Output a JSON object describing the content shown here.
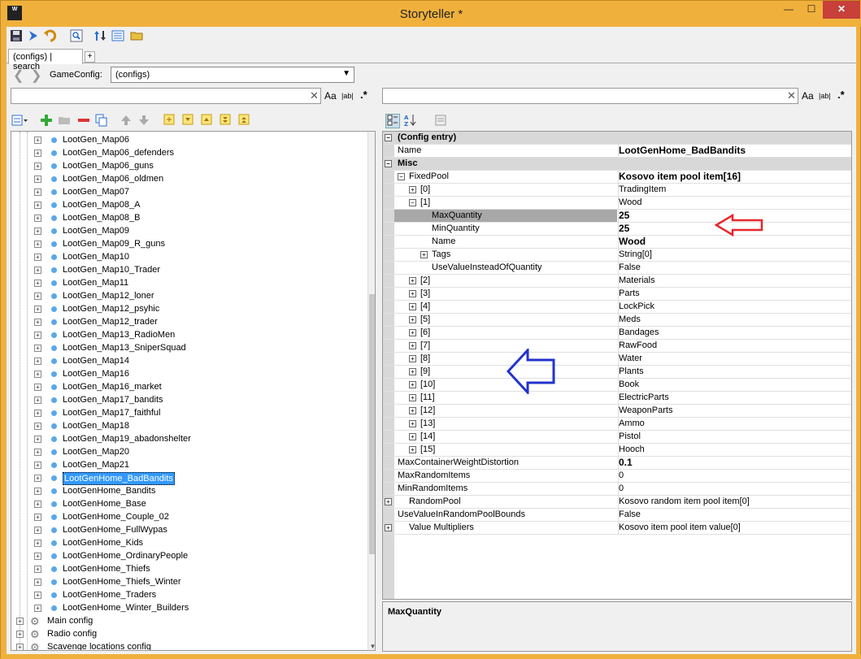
{
  "window": {
    "title": "Storyteller *",
    "min": "—",
    "max": "☐",
    "close": "✕",
    "icon_text": "W"
  },
  "toolbar": {
    "icons": [
      "save-icon",
      "run-icon",
      "undo-icon",
      "find-icon",
      "sort-icon",
      "list-icon",
      "folder-icon"
    ]
  },
  "tabs": [
    {
      "label": "(configs) | search"
    }
  ],
  "tab_add": "+",
  "nav": {
    "back": "❮",
    "forward": "❯",
    "label": "GameConfig:",
    "selected": "(configs)"
  },
  "left_search": {
    "value": "",
    "clear": "✕",
    "opt_case": "Aa",
    "opt_word": "|ab|",
    "opt_regex": ".*"
  },
  "right_search": {
    "value": "",
    "clear": "✕",
    "opt_case": "Aa",
    "opt_word": "|ab|",
    "opt_regex": ".*"
  },
  "tree": {
    "items": [
      "LootGen_Map06",
      "LootGen_Map06_defenders",
      "LootGen_Map06_guns",
      "LootGen_Map06_oldmen",
      "LootGen_Map07",
      "LootGen_Map08_A",
      "LootGen_Map08_B",
      "LootGen_Map09",
      "LootGen_Map09_R_guns",
      "LootGen_Map10",
      "LootGen_Map10_Trader",
      "LootGen_Map11",
      "LootGen_Map12_loner",
      "LootGen_Map12_psyhic",
      "LootGen_Map12_trader",
      "LootGen_Map13_RadioMen",
      "LootGen_Map13_SniperSquad",
      "LootGen_Map14",
      "LootGen_Map16",
      "LootGen_Map16_market",
      "LootGen_Map17_bandits",
      "LootGen_Map17_faithful",
      "LootGen_Map18",
      "LootGen_Map19_abadonshelter",
      "LootGen_Map20",
      "LootGen_Map21",
      "LootGenHome_BadBandits",
      "LootGenHome_Bandits",
      "LootGenHome_Base",
      "LootGenHome_Couple_02",
      "LootGenHome_FullWypas",
      "LootGenHome_Kids",
      "LootGenHome_OrdinaryPeople",
      "LootGenHome_Thiefs",
      "LootGenHome_Thiefs_Winter",
      "LootGenHome_Traders",
      "LootGenHome_Winter_Builders"
    ],
    "selected_index": 26,
    "roots": [
      "Main config",
      "Radio config",
      "Scavenge locations config"
    ]
  },
  "grid": {
    "rows": [
      {
        "type": "cat",
        "name": "(Config entry)",
        "value": "",
        "pm": "⊟",
        "indent": 0
      },
      {
        "type": "prop",
        "name": "Name",
        "value": "LootGenHome_BadBandits",
        "bold": true,
        "indent": 0
      },
      {
        "type": "cat",
        "name": "Misc",
        "value": "",
        "pm": "⊟",
        "indent": 0
      },
      {
        "type": "prop",
        "name": "FixedPool",
        "value": "Kosovo item pool item[16]",
        "bold": true,
        "pm": "⊟",
        "indent": 0
      },
      {
        "type": "prop",
        "name": "[0]",
        "value": "TradingItem",
        "pm": "⊞",
        "indent": 1
      },
      {
        "type": "prop",
        "name": "[1]",
        "value": "Wood",
        "pm": "⊟",
        "indent": 1
      },
      {
        "type": "prop",
        "name": "MaxQuantity",
        "value": "25",
        "bold": true,
        "indent": 2,
        "selected": true
      },
      {
        "type": "prop",
        "name": "MinQuantity",
        "value": "25",
        "bold": true,
        "indent": 2
      },
      {
        "type": "prop",
        "name": "Name",
        "value": "Wood",
        "bold": true,
        "indent": 2
      },
      {
        "type": "prop",
        "name": "Tags",
        "value": "String[0]",
        "pm": "⊞",
        "indent": 2
      },
      {
        "type": "prop",
        "name": "UseValueInsteadOfQuantity",
        "value": "False",
        "indent": 2
      },
      {
        "type": "prop",
        "name": "[2]",
        "value": "Materials",
        "pm": "⊞",
        "indent": 1
      },
      {
        "type": "prop",
        "name": "[3]",
        "value": "Parts",
        "pm": "⊞",
        "indent": 1
      },
      {
        "type": "prop",
        "name": "[4]",
        "value": "LockPick",
        "pm": "⊞",
        "indent": 1
      },
      {
        "type": "prop",
        "name": "[5]",
        "value": "Meds",
        "pm": "⊞",
        "indent": 1
      },
      {
        "type": "prop",
        "name": "[6]",
        "value": "Bandages",
        "pm": "⊞",
        "indent": 1
      },
      {
        "type": "prop",
        "name": "[7]",
        "value": "RawFood",
        "pm": "⊞",
        "indent": 1
      },
      {
        "type": "prop",
        "name": "[8]",
        "value": "Water",
        "pm": "⊞",
        "indent": 1
      },
      {
        "type": "prop",
        "name": "[9]",
        "value": "Plants",
        "pm": "⊞",
        "indent": 1
      },
      {
        "type": "prop",
        "name": "[10]",
        "value": "Book",
        "pm": "⊞",
        "indent": 1
      },
      {
        "type": "prop",
        "name": "[11]",
        "value": "ElectricParts",
        "pm": "⊞",
        "indent": 1
      },
      {
        "type": "prop",
        "name": "[12]",
        "value": "WeaponParts",
        "pm": "⊞",
        "indent": 1
      },
      {
        "type": "prop",
        "name": "[13]",
        "value": "Ammo",
        "pm": "⊞",
        "indent": 1
      },
      {
        "type": "prop",
        "name": "[14]",
        "value": "Pistol",
        "pm": "⊞",
        "indent": 1
      },
      {
        "type": "prop",
        "name": "[15]",
        "value": "Hooch",
        "pm": "⊞",
        "indent": 1
      },
      {
        "type": "prop",
        "name": "MaxContainerWeightDistortion",
        "value": "0.1",
        "bold": true,
        "indent": 0
      },
      {
        "type": "prop",
        "name": "MaxRandomItems",
        "value": "0",
        "indent": 0
      },
      {
        "type": "prop",
        "name": "MinRandomItems",
        "value": "0",
        "indent": 0
      },
      {
        "type": "prop",
        "name": "RandomPool",
        "value": "Kosovo random item pool item[0]",
        "pm": "⊞",
        "indent": 0,
        "gutterpm": true
      },
      {
        "type": "prop",
        "name": "UseValueInRandomPoolBounds",
        "value": "False",
        "indent": 0
      },
      {
        "type": "prop",
        "name": "Value Multipliers",
        "value": "Kosovo item pool item value[0]",
        "pm": "⊞",
        "indent": 0,
        "gutterpm": true
      }
    ]
  },
  "description": {
    "title": "MaxQuantity"
  },
  "colors": {
    "title_bg": "#f0b13c",
    "close": "#c7403a",
    "selection": "#3399ff",
    "red_arrow": "#e8262a",
    "blue_arrow": "#2233cc"
  }
}
